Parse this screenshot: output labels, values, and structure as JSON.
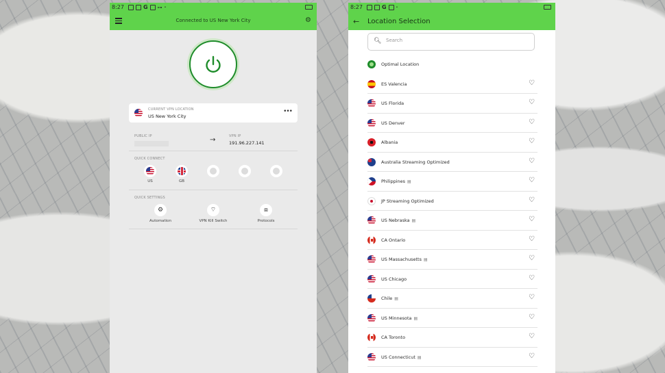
{
  "status_bar": {
    "time": "8:27"
  },
  "left": {
    "header_title": "Connected to US New York City",
    "current_location": {
      "label": "CURRENT VPN LOCATION",
      "value": "US New York City"
    },
    "public_ip": {
      "label": "PUBLIC IP",
      "value": ""
    },
    "vpn_ip": {
      "label": "VPN IP",
      "value": "191.96.227.141"
    },
    "quick_connect": {
      "label": "QUICK CONNECT",
      "items": [
        "US",
        "GB"
      ]
    },
    "quick_settings": {
      "label": "QUICK SETTINGS",
      "items": [
        "Automation",
        "VPN Kill Switch",
        "Protocols"
      ]
    }
  },
  "right": {
    "title": "Location Selection",
    "search_placeholder": "Search",
    "optimal": "Optimal Location",
    "locations": [
      {
        "name": "ES Valencia",
        "flag": "es",
        "server_icon": false
      },
      {
        "name": "US Florida",
        "flag": "us",
        "server_icon": false
      },
      {
        "name": "US Denver",
        "flag": "us",
        "server_icon": false
      },
      {
        "name": "Albania",
        "flag": "al",
        "server_icon": false
      },
      {
        "name": "Australia Streaming Optimized",
        "flag": "au",
        "server_icon": false
      },
      {
        "name": "Philippines",
        "flag": "ph",
        "server_icon": true
      },
      {
        "name": "JP Streaming Optimized",
        "flag": "jp",
        "server_icon": false
      },
      {
        "name": "US Nebraska",
        "flag": "us",
        "server_icon": true
      },
      {
        "name": "CA Ontario",
        "flag": "ca",
        "server_icon": false
      },
      {
        "name": "US Massachusetts",
        "flag": "us",
        "server_icon": true
      },
      {
        "name": "US Chicago",
        "flag": "us",
        "server_icon": false
      },
      {
        "name": "Chile",
        "flag": "cl",
        "server_icon": true
      },
      {
        "name": "US Minnesota",
        "flag": "us",
        "server_icon": true
      },
      {
        "name": "CA Toronto",
        "flag": "ca",
        "server_icon": false
      },
      {
        "name": "US Connecticut",
        "flag": "us",
        "server_icon": true
      }
    ]
  },
  "colors": {
    "accent": "#5fd34b",
    "power_ring": "#1e8c2a"
  },
  "icons": {
    "favorite": "heart-icon",
    "server": "server-icon"
  }
}
